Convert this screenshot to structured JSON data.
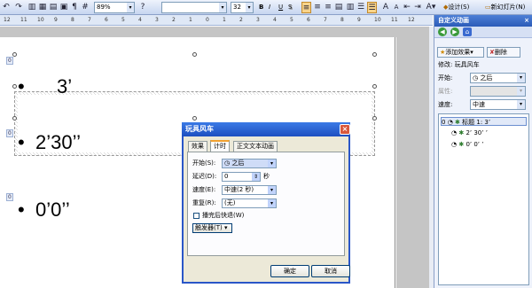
{
  "toolbar": {
    "zoom": "89%",
    "font_name": "",
    "font_size": "32",
    "bold": "B",
    "italic": "I",
    "underline": "U",
    "shadow": "S",
    "design_label": "设计(S)",
    "new_slide_label": "新幻灯片(N)"
  },
  "ruler": {
    "ticks": [
      "12",
      "11",
      "10",
      "9",
      "8",
      "7",
      "6",
      "5",
      "4",
      "3",
      "2",
      "1",
      "0",
      "1",
      "2",
      "3",
      "4",
      "5",
      "6",
      "7",
      "8",
      "9",
      "10",
      "11",
      "12"
    ]
  },
  "slide": {
    "tags": [
      "0",
      "0",
      "0"
    ],
    "lines": [
      "3’",
      "2’30’’",
      "0’0’’"
    ],
    "bullet": "•"
  },
  "pane": {
    "title": "自定义动画",
    "close": "×",
    "add_effect": "添加效果",
    "remove": "删除",
    "modify_label": "修改: 玩具风车",
    "start_label": "开始:",
    "start_value": "之后",
    "property_label": "属性:",
    "property_value": "",
    "speed_label": "速度:",
    "speed_value": "中速",
    "items": [
      {
        "index": "0",
        "text": "标题 1: 3’"
      },
      {
        "index": "",
        "text": "2’ 30’ ’"
      },
      {
        "index": "",
        "text": "0’ 0’ ’"
      }
    ]
  },
  "dialog": {
    "title": "玩具风车",
    "close": "×",
    "tabs": [
      "效果",
      "计时",
      "正文文本动画"
    ],
    "start_label": "开始(S):",
    "start_value": "之后",
    "delay_label": "延迟(D):",
    "delay_value": "0",
    "delay_unit": "秒",
    "speed_label": "速度(E):",
    "speed_value": "中速(2 秒)",
    "repeat_label": "重复(R):",
    "repeat_value": "(无)",
    "rewind_label": "播完后快退(W)",
    "trigger_label": "触发器(T)",
    "ok": "确定",
    "cancel": "取消"
  }
}
